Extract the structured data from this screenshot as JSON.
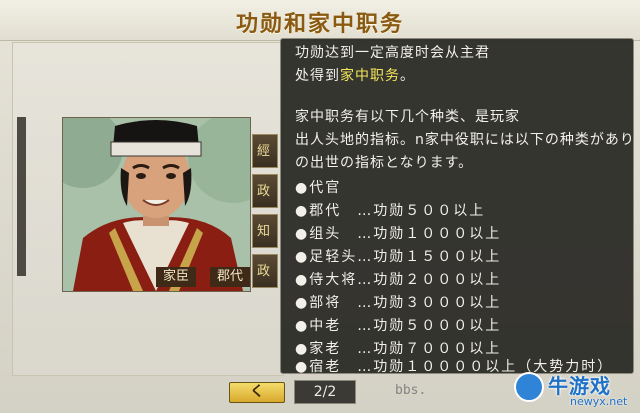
{
  "window": {
    "title": "功勋和家中职务"
  },
  "portrait": {
    "rank_label": "家臣",
    "role_label": "郡代"
  },
  "tabs": [
    "經",
    "政",
    "知",
    "政"
  ],
  "tooltip": {
    "lines": [
      {
        "text": "功勋达到一定高度时会从主君",
        "segments": null
      },
      {
        "text": null,
        "segments": [
          {
            "t": "处得到"
          },
          {
            "t": "家中职务",
            "hl": true
          },
          {
            "t": "。"
          }
        ]
      },
      {
        "text": "",
        "segments": null
      },
      {
        "text": "家中职务有以下几个种类、是玩家",
        "segments": null
      },
      {
        "text": "出人头地的指标。n家中役职には以下の种类があり",
        "segments": null
      },
      {
        "text": "の出世の指标となります。",
        "segments": null
      }
    ],
    "ranks": [
      "●代官",
      "●郡代　…功勋５００以上",
      "●组头　…功勋１０００以上",
      "●足轻头…功勋１５００以上",
      "●侍大将…功勋２０００以上",
      "●部将　…功勋３０００以上",
      "●中老　…功勋５０００以上",
      "●家老　…功勋７０００以上",
      "●宿老　…功勋１００００以上（大势力时）"
    ]
  },
  "nav": {
    "back_label": "く",
    "page_indicator": "2/2"
  },
  "watermark": {
    "url_text": "bbs.",
    "brand": "牛游戏",
    "domain": "newyx.net"
  },
  "colors": {
    "highlight": "#f3e55a",
    "title": "#8a5a12",
    "tooltip_bg": "#282824"
  }
}
